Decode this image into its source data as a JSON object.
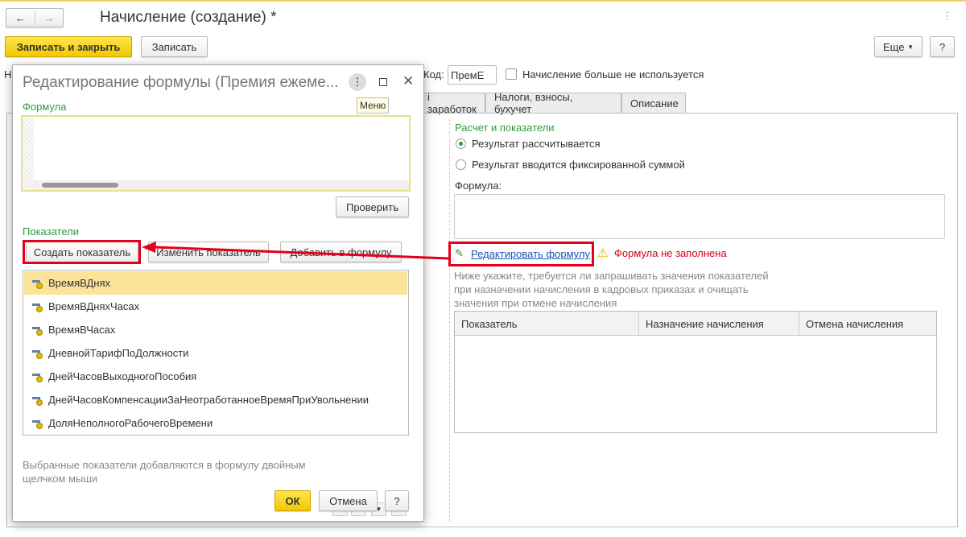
{
  "window": {
    "title": "Начисление (создание) *",
    "more_icon": "⋮"
  },
  "toolbar": {
    "save_close": "Записать и закрыть",
    "save": "Записать",
    "more": "Еще",
    "help": "?"
  },
  "form": {
    "name_label_partial": "Н",
    "code_label": "Код:",
    "code_value": "ПремЕ",
    "not_used_label": "Начисление больше не используется"
  },
  "tabs": [
    {
      "label": "і заработок"
    },
    {
      "label": "Налоги, взносы, бухучет"
    },
    {
      "label": "Описание"
    }
  ],
  "calc": {
    "group_title": "Расчет и показатели",
    "radio_calc": "Результат рассчитывается",
    "radio_fixed": "Результат вводится фиксированной суммой",
    "formula_label": "Формула:",
    "edit_formula_link": "Редактировать формулу",
    "warning": "Формула не заполнена",
    "hint": "Ниже укажите, требуется ли запрашивать значения показателей при назначении начисления в кадровых приказах и очищать значения при отмене начисления",
    "table_headers": [
      "Показатель",
      "Назначение начисления",
      "Отмена начисления"
    ]
  },
  "dialog": {
    "title": "Редактирование формулы (Премия ежеме...",
    "tooltip": "Меню",
    "formula_label": "Формула",
    "check_button": "Проверить",
    "indicators_label": "Показатели",
    "create_button": "Создать показатель",
    "edit_button": "Изменить показатель",
    "add_button": "Добавить в формулу",
    "items": [
      "ВремяВДнях",
      "ВремяВДняхЧасах",
      "ВремяВЧасах",
      "ДневнойТарифПоДолжности",
      "ДнейЧасовВыходногоПособия",
      "ДнейЧасовКомпенсацииЗаНеотработанноеВремяПриУвольнении",
      "ДоляНеполногоРабочегоВремени"
    ],
    "footer_hint": "Выбранные показатели добавляются в формулу двойным щелчком мыши",
    "ok": "ОК",
    "cancel": "Отмена",
    "help": "?"
  },
  "colors": {
    "accent_yellow": "#f2c800",
    "green": "#2f9a3f",
    "highlight_red": "#e3001b",
    "selected_row": "#fbe49a"
  }
}
